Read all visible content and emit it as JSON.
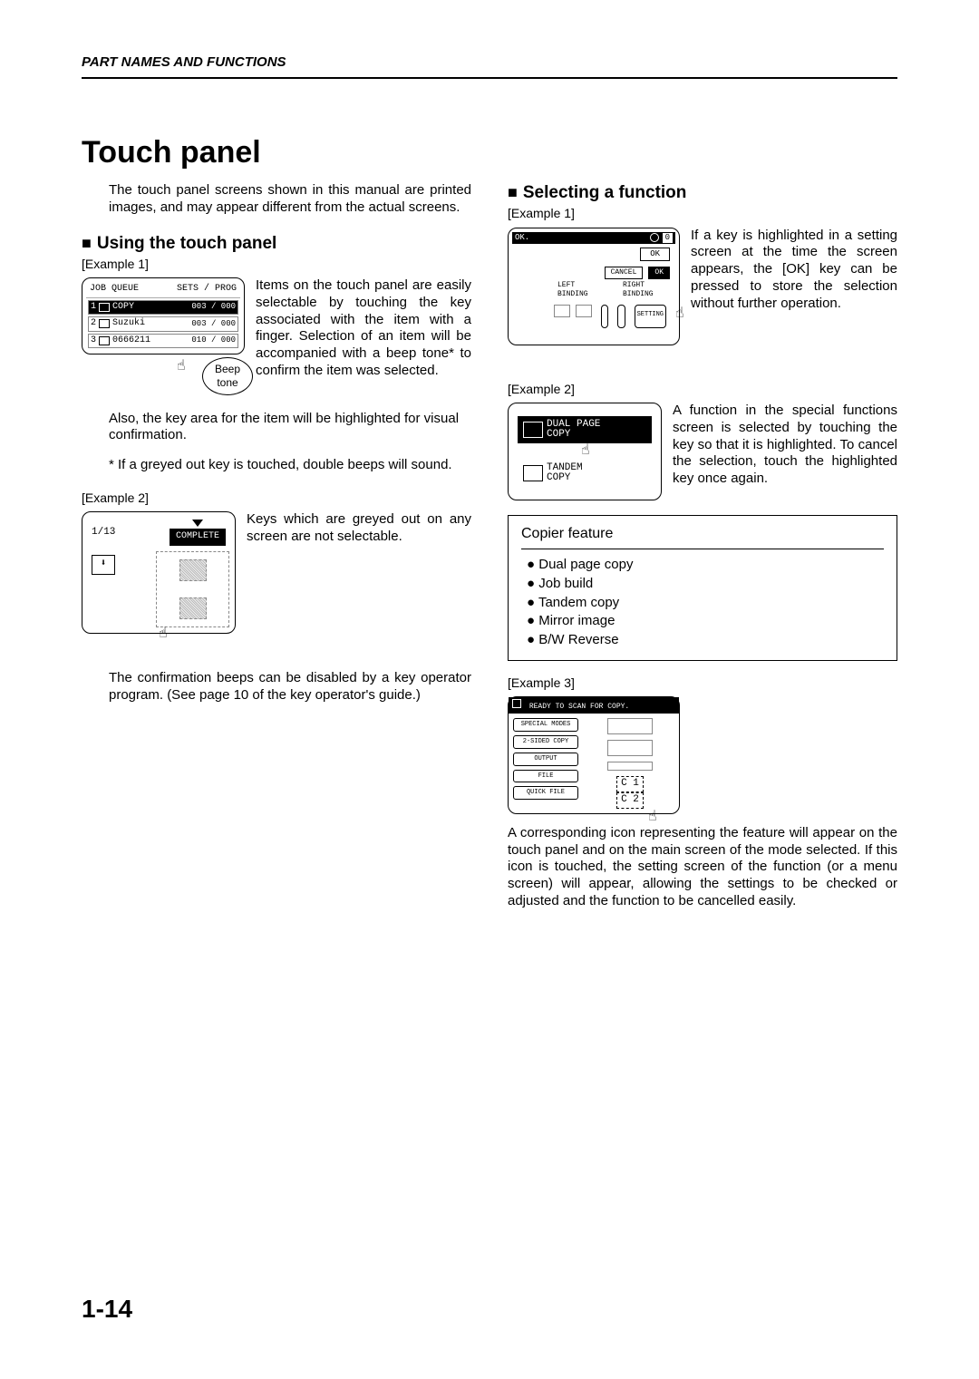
{
  "header": "PART NAMES AND FUNCTIONS",
  "title": "Touch panel",
  "intro": "The touch panel screens shown in this manual are printed images, and may appear different from the actual screens.",
  "left": {
    "h2": "Using the touch panel",
    "ex1_label": "[Example 1]",
    "job_header_left": "JOB QUEUE",
    "job_header_right": "SETS / PROG",
    "job_rows": [
      {
        "n": "1",
        "label": "COPY",
        "count": "003 / 000"
      },
      {
        "n": "2",
        "label": "Suzuki",
        "count": "003 / 000"
      },
      {
        "n": "3",
        "label": "0666211",
        "count": "010 / 000"
      }
    ],
    "beep": "Beep tone",
    "p1a": "Items on the touch panel are easily selectable by touching the key associ­ated with the item with a finger. Selection of an item will be accompanied with a beep tone* to confirm the item was selected.",
    "p1b": "Also, the key area for the item will be highlighted for visual confirmation.",
    "note": "* If a greyed out key is touched, double beeps will sound.",
    "ex2_label": "[Example 2]",
    "ex2_frac": "1/13",
    "ex2_complete": "COMPLETE",
    "p2": "Keys which are greyed out on any screen are not selectable.",
    "p3": "The confirmation beeps can be disabled by a key operator program. (See page 10 of the key operator's guide.)"
  },
  "right": {
    "h2": "Selecting a function",
    "ex1_label": "[Example 1]",
    "panel1": {
      "top_left": "OK.",
      "top_right_num": "0",
      "ok": "OK",
      "cancel": "CANCEL",
      "ok2": "OK",
      "left_bind": "LEFT BINDING",
      "right_bind": "RIGHT BINDING",
      "setting": "SETTING"
    },
    "p1": "If a key is highlighted in a setting screen at the time the screen appears, the [OK] key can be pressed to store the selection without further operation.",
    "ex2_label": "[Example 2]",
    "panel2": {
      "r1a": "DUAL PAGE",
      "r1b": "COPY",
      "r2a": "TANDEM",
      "r2b": "COPY"
    },
    "p2": "A function in the special functions screen is selected by touching the key so that it is highlighted. To cancel the selection, touch the highlighted key once again.",
    "feature_title": "Copier feature",
    "features": [
      "Dual page copy",
      "Job build",
      "Tandem copy",
      "Mirror image",
      "B/W Reverse"
    ],
    "ex3_label": "[Example 3]",
    "panel3": {
      "top": "READY TO SCAN FOR COPY.",
      "btns": [
        "SPECIAL MODES",
        "2-SIDED COPY",
        "OUTPUT",
        "FILE",
        "QUICK FILE"
      ],
      "c1": "C 1",
      "c2": "C 2"
    },
    "p3": "A corresponding icon representing the feature will appear on the touch panel and on the main screen of the mode selected. If this icon is touched, the setting screen of the function (or a menu screen) will appear, allowing the settings to be checked or adjusted and the function to be cancelled easily."
  },
  "page_number": "1-14"
}
